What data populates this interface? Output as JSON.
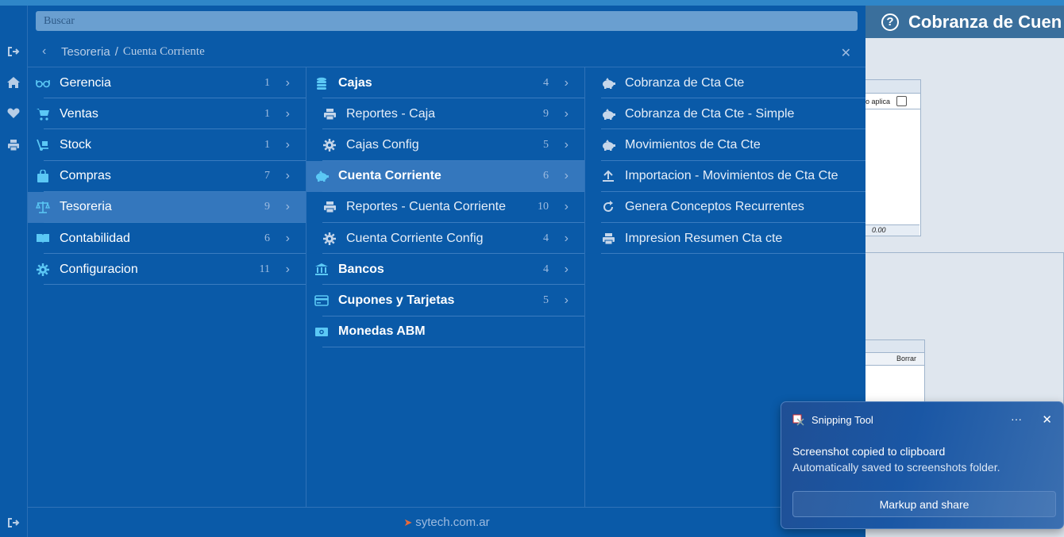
{
  "search": {
    "placeholder": "Buscar"
  },
  "breadcrumb": {
    "level1": "Tesoreria",
    "separator": "/",
    "level2": "Cuenta Corriente"
  },
  "col1": [
    {
      "label": "Gerencia",
      "count": "1",
      "icon": "glasses-icon"
    },
    {
      "label": "Ventas",
      "count": "1",
      "icon": "cart-icon"
    },
    {
      "label": "Stock",
      "count": "1",
      "icon": "dolly-icon"
    },
    {
      "label": "Compras",
      "count": "7",
      "icon": "bag-icon"
    },
    {
      "label": "Tesoreria",
      "count": "9",
      "icon": "balance-scale-icon",
      "selected": true
    },
    {
      "label": "Contabilidad",
      "count": "6",
      "icon": "book-icon"
    },
    {
      "label": "Configuracion",
      "count": "11",
      "icon": "gear-icon"
    }
  ],
  "col2": [
    {
      "label": "Cajas",
      "count": "4",
      "icon": "coins-icon",
      "bold": true
    },
    {
      "label": "Reportes - Caja",
      "count": "9",
      "icon": "printer-icon"
    },
    {
      "label": "Cajas Config",
      "count": "5",
      "icon": "gear-icon"
    },
    {
      "label": "Cuenta Corriente",
      "count": "6",
      "icon": "piggy-bank-icon",
      "bold": true,
      "selected": true
    },
    {
      "label": "Reportes - Cuenta Corriente",
      "count": "10",
      "icon": "printer-icon"
    },
    {
      "label": "Cuenta Corriente Config",
      "count": "4",
      "icon": "gear-icon"
    },
    {
      "label": "Bancos",
      "count": "4",
      "icon": "bank-icon",
      "bold": true
    },
    {
      "label": "Cupones y Tarjetas",
      "count": "5",
      "icon": "credit-card-icon",
      "bold": true
    },
    {
      "label": "Monedas ABM",
      "count": "",
      "icon": "money-bill-icon",
      "bold": true
    }
  ],
  "col3": [
    {
      "label": "Cobranza de Cta Cte",
      "icon": "piggy-bank-icon"
    },
    {
      "label": "Cobranza de Cta Cte - Simple",
      "icon": "piggy-bank-icon"
    },
    {
      "label": "Movimientos de Cta Cte",
      "icon": "piggy-bank-icon"
    },
    {
      "label": "Importacion - Movimientos de Cta Cte",
      "icon": "upload-icon"
    },
    {
      "label": "Genera Conceptos Recurrentes",
      "icon": "redo-icon"
    },
    {
      "label": "Impresion Resumen Cta cte",
      "icon": "printer-icon"
    }
  ],
  "footer": {
    "brand": "sytech.com.ar"
  },
  "app": {
    "title": "Cobranza de Cuen",
    "grid1": {
      "header_text": "o aplica",
      "total": "0.00"
    },
    "grid2": {
      "column": "Borrar"
    }
  },
  "toast": {
    "app_name": "Snipping Tool",
    "line1": "Screenshot copied to clipboard",
    "line2": "Automatically saved to screenshots folder.",
    "button": "Markup and share"
  },
  "colors": {
    "menu_bg": "#0a5aa8",
    "selected_bg": "#3477bd",
    "accent_icon": "#5bc8f5",
    "app_header": "#3a6f9c"
  }
}
